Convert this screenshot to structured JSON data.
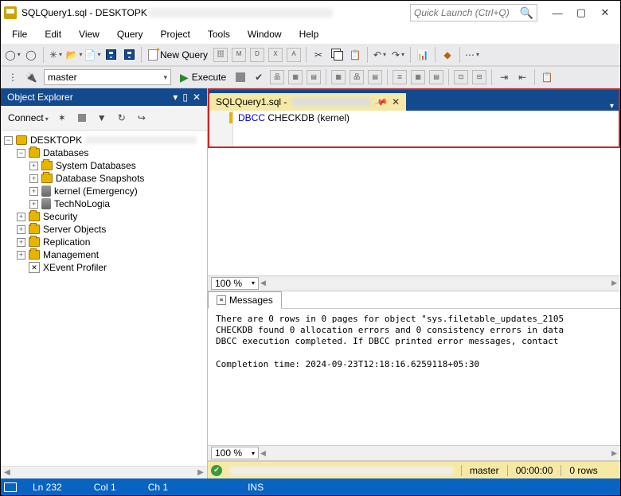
{
  "title": {
    "filename": "SQLQuery1.sql",
    "server_prefix": "DESKTOPK"
  },
  "quicklaunch": {
    "placeholder": "Quick Launch (Ctrl+Q)"
  },
  "menu": [
    "File",
    "Edit",
    "View",
    "Query",
    "Project",
    "Tools",
    "Window",
    "Help"
  ],
  "toolbar1": {
    "newquery": "New Query"
  },
  "toolbar2": {
    "db_selected": "master",
    "execute": "Execute"
  },
  "explorer": {
    "title": "Object Explorer",
    "connect": "Connect",
    "root": {
      "label_prefix": "DESKTOPK"
    },
    "databases": "Databases",
    "db_children": [
      "System Databases",
      "Database Snapshots",
      "kernel (Emergency)",
      "TechNoLogia"
    ],
    "root_children": [
      "Security",
      "Server Objects",
      "Replication",
      "Management",
      "XEvent Profiler"
    ]
  },
  "filetab": {
    "name": "SQLQuery1.sql - "
  },
  "code": {
    "kw": "DBCC",
    "rest": " CHECKDB (kernel)"
  },
  "zoom": "100 %",
  "msgtab": "Messages",
  "messages": "There are 0 rows in 0 pages for object \"sys.filetable_updates_2105\nCHECKDB found 0 allocation errors and 0 consistency errors in data\nDBCC execution completed. If DBCC printed error messages, contact \n\nCompletion time: 2024-09-23T12:18:16.6259118+05:30",
  "resultbar": {
    "db": "master",
    "time": "00:00:00",
    "rows": "0 rows"
  },
  "statusbar": {
    "ln": "Ln 232",
    "col": "Col 1",
    "ch": "Ch 1",
    "ins": "INS"
  }
}
